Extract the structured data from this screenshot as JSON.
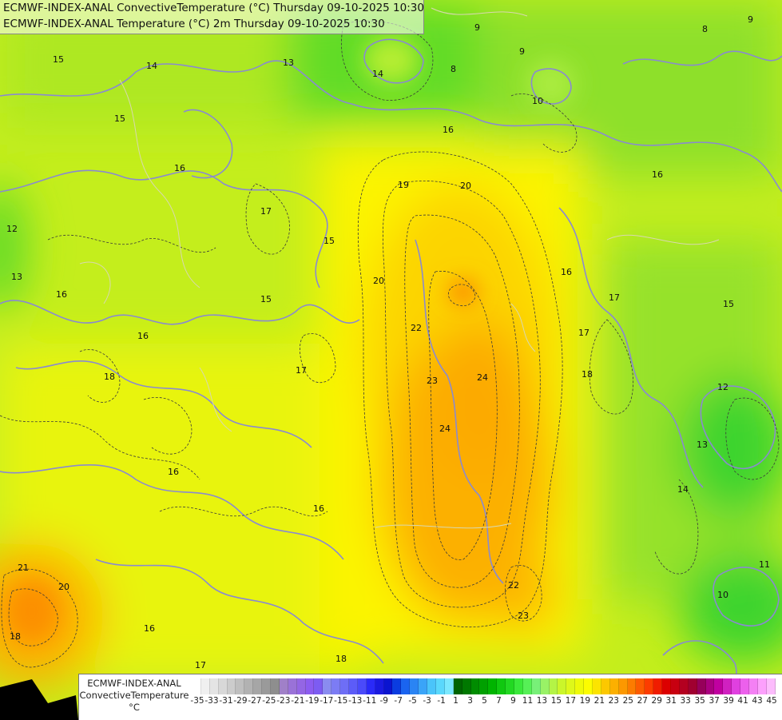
{
  "title": {
    "line1": "ECMWF-INDEX-ANAL ConvectiveTemperature (°C) Thursday 09-10-2025 10:30",
    "line2": "ECMWF-INDEX-ANAL Temperature (°C) 2m Thursday 09-10-2025 10:30"
  },
  "legend": {
    "title_line1": "ECMWF-INDEX-ANAL",
    "title_line2": "ConvectiveTemperature",
    "unit": "°C",
    "ticks": [
      "-35",
      "-33",
      "-31",
      "-29",
      "-27",
      "-25",
      "-23",
      "-21",
      "-19",
      "-17",
      "-15",
      "-13",
      "-11",
      "-9",
      "-7",
      "-5",
      "-3",
      "-1",
      "1",
      "3",
      "5",
      "7",
      "9",
      "11",
      "13",
      "15",
      "17",
      "19",
      "21",
      "23",
      "25",
      "27",
      "29",
      "31",
      "33",
      "35",
      "37",
      "39",
      "41",
      "43",
      "45"
    ],
    "colors": [
      "#ffffff",
      "#f0f0f0",
      "#e4e4e4",
      "#d8d8d8",
      "#cccccc",
      "#bfbfbf",
      "#b2b2b2",
      "#a6a6a6",
      "#9a9a9a",
      "#8e8e8e",
      "#a080c8",
      "#9a72d8",
      "#9466e4",
      "#8c5cf0",
      "#7d5cf2",
      "#8a8cf0",
      "#7c7cf4",
      "#6e6ef6",
      "#5c5cf8",
      "#4a4afa",
      "#2a2af8",
      "#1a1ae0",
      "#0a14d0",
      "#0a3ce0",
      "#1a64f0",
      "#2a84f4",
      "#3aa4f8",
      "#4ac4fa",
      "#5ad8fc",
      "#7ae8fe",
      "#006400",
      "#007800",
      "#008c00",
      "#00a000",
      "#00b400",
      "#10c810",
      "#22d822",
      "#3ae83a",
      "#56f056",
      "#78f078",
      "#99f266",
      "#b4f446",
      "#cbf62a",
      "#def81a",
      "#eefa08",
      "#fcfc00",
      "#fce400",
      "#fcc800",
      "#fcb000",
      "#fc9800",
      "#fc7c00",
      "#fc5c00",
      "#fc3c00",
      "#f01c00",
      "#dc0000",
      "#c80010",
      "#b40020",
      "#a00030",
      "#96005a",
      "#aa0080",
      "#c000a0",
      "#d020c0",
      "#e040e0",
      "#ec60ec",
      "#f480f4",
      "#fca0fc",
      "#fcbcfc"
    ],
    "bottom_label": "1"
  },
  "contour_labels": [
    "15",
    "14",
    "15",
    "16",
    "16",
    "17",
    "18",
    "15",
    "15",
    "17",
    "19",
    "20",
    "16",
    "16",
    "17",
    "18",
    "17",
    "22",
    "23",
    "24",
    "24",
    "20",
    "21",
    "20",
    "18",
    "16",
    "17",
    "18",
    "16",
    "16",
    "22",
    "23",
    "12",
    "13",
    "14",
    "10",
    "9",
    "9",
    "8",
    "8",
    "9",
    "10",
    "14",
    "13",
    "16",
    "15",
    "12",
    "13",
    "11",
    "16"
  ]
}
